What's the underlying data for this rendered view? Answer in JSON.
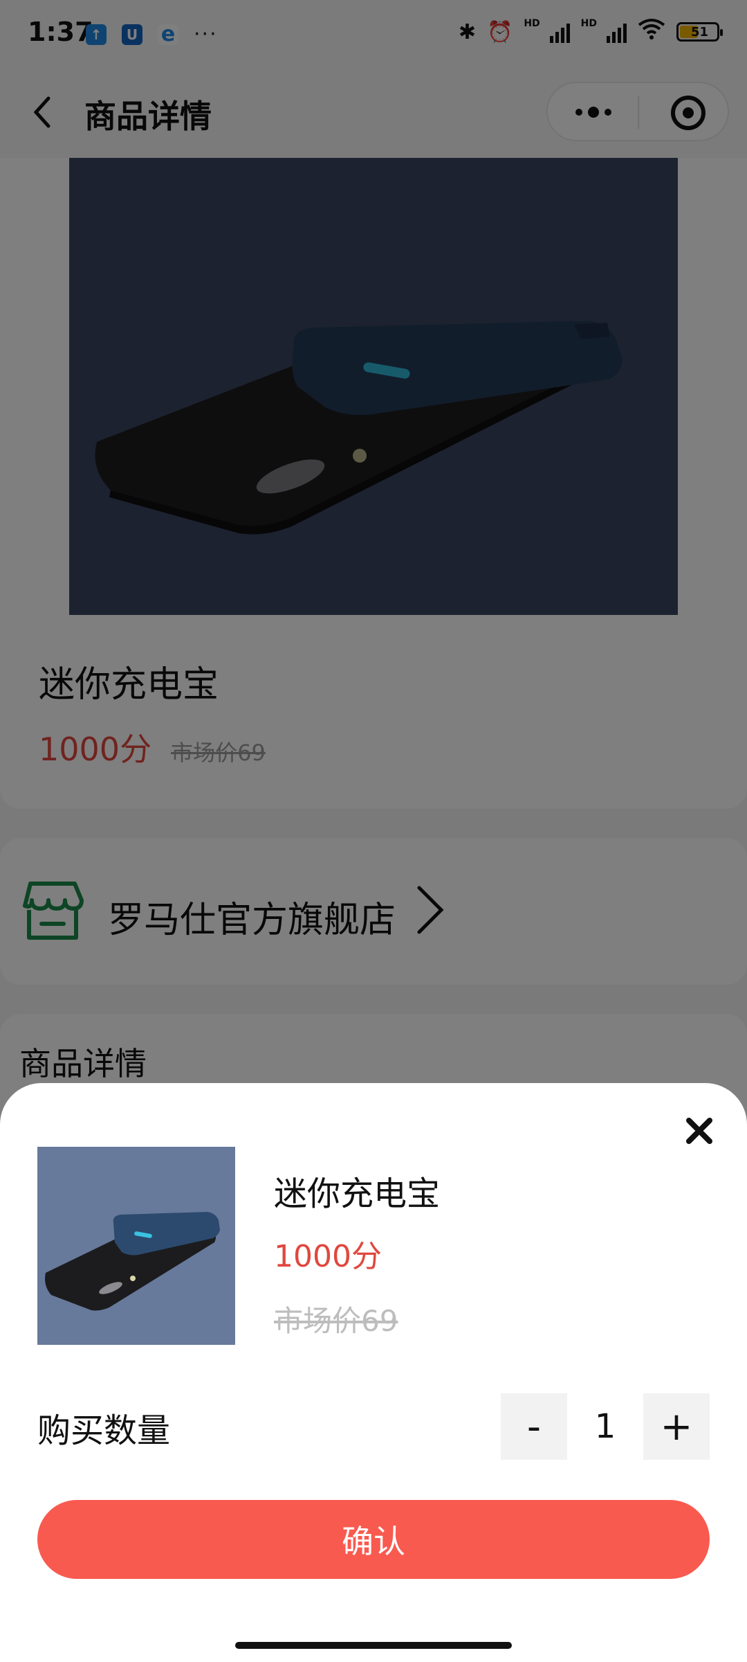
{
  "status_bar": {
    "time": "1:37",
    "app_icons": [
      "upload-icon",
      "u-app-icon",
      "browser-icon"
    ],
    "more": "···",
    "battery": "51",
    "hd1": "HD",
    "hd2": "HD"
  },
  "nav": {
    "title": "商品详情"
  },
  "product": {
    "name": "迷你充电宝",
    "price": "1000分",
    "market_price": "市场价69",
    "image_colors": {
      "background": "#3a4560",
      "phone": "#1c1c1e",
      "powerbank": "#243a56",
      "led": "#2fb6d6"
    }
  },
  "store": {
    "name": "罗马仕官方旗舰店",
    "icon_color": "#1a8a4a"
  },
  "detail": {
    "title": "商品详情"
  },
  "sheet": {
    "name": "迷你充电宝",
    "price": "1000分",
    "market_price": "市场价69",
    "qty_label": "购买数量",
    "minus": "-",
    "qty": "1",
    "plus": "+",
    "confirm": "确认",
    "confirm_color": "#f95a4f",
    "price_color": "#e0473e"
  }
}
